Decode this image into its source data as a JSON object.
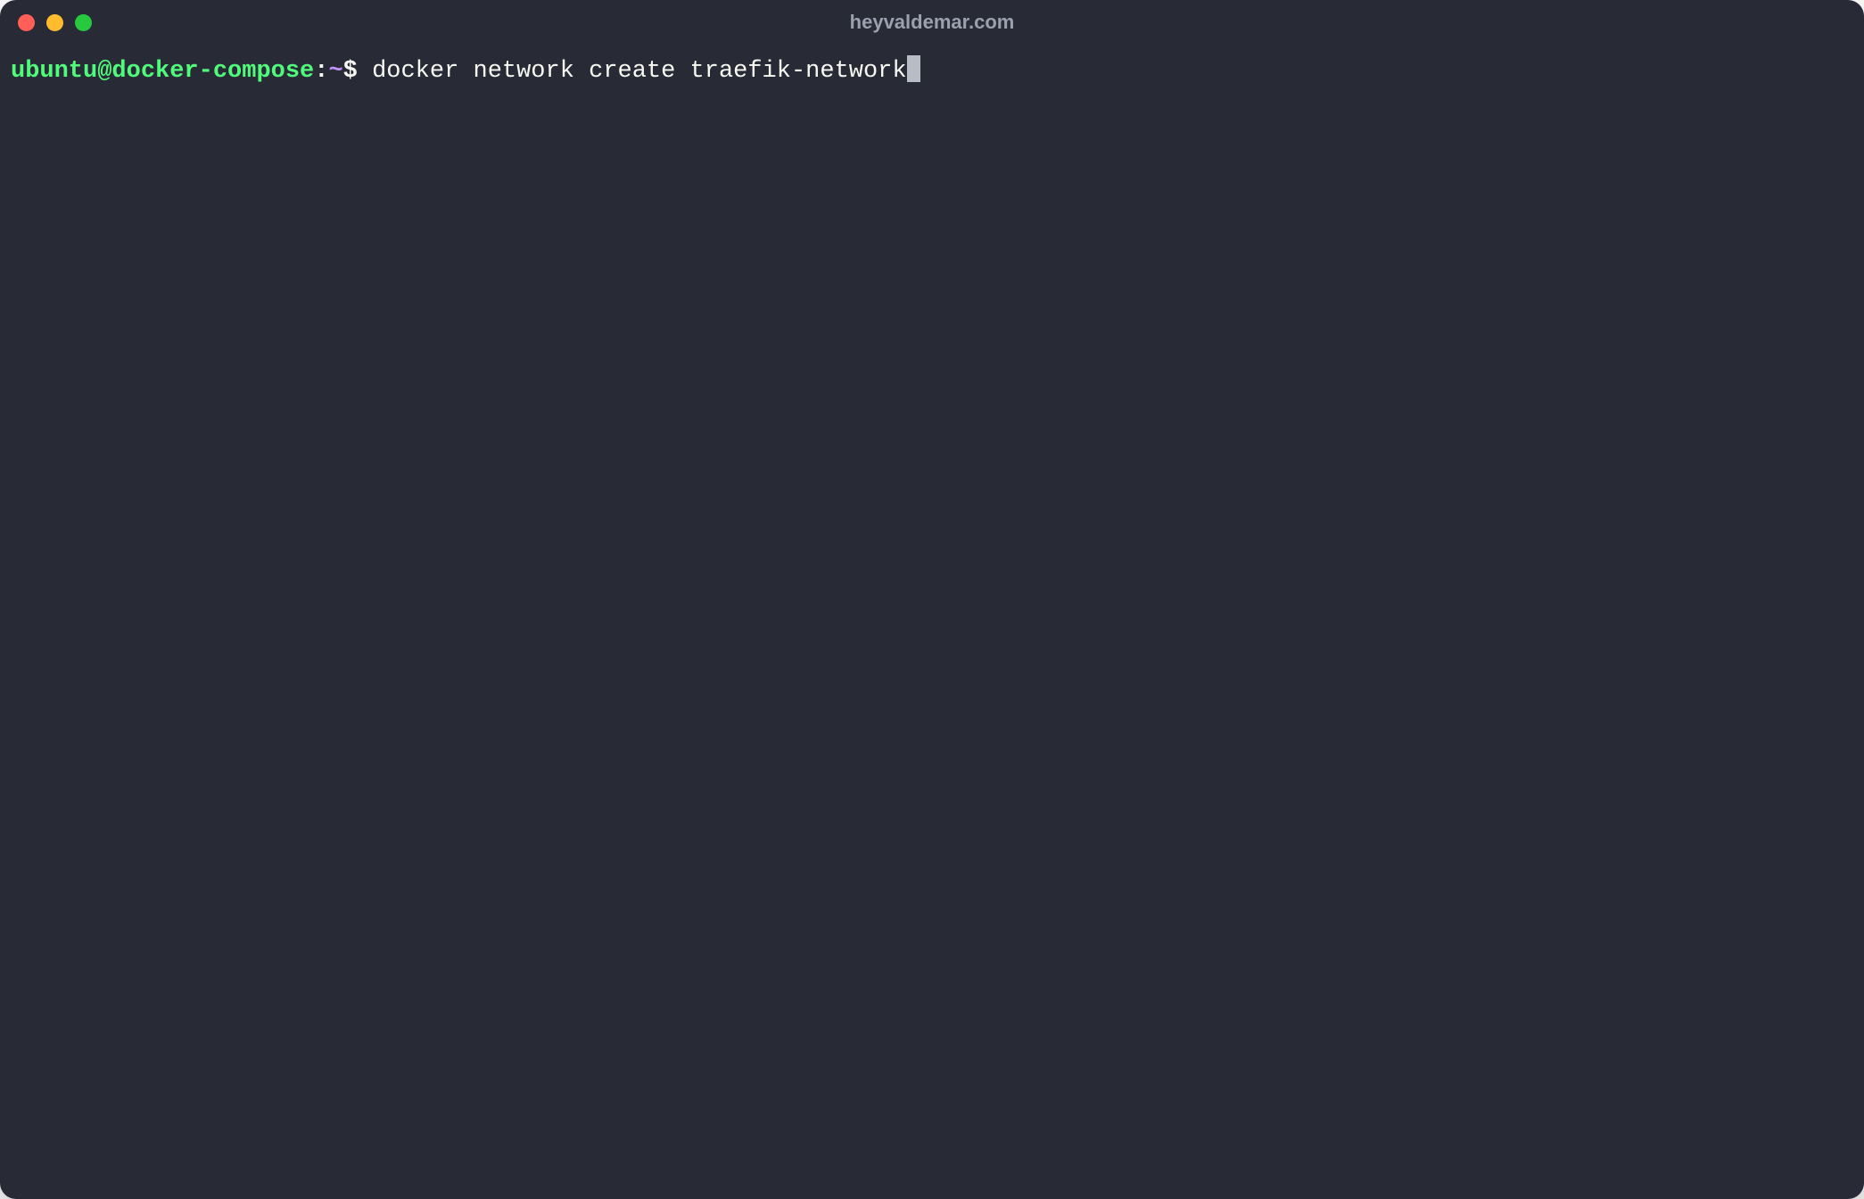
{
  "window": {
    "title": "heyvaldemar.com"
  },
  "prompt": {
    "user_host": "ubuntu@docker-compose",
    "colon": ":",
    "path": "~",
    "symbol": "$"
  },
  "command": "docker network create traefik-network",
  "colors": {
    "background": "#282a36",
    "user_host": "#50fa7b",
    "path": "#bd93f9",
    "text": "#f8f8f2",
    "title": "#9ca0ae",
    "close": "#ff5f56",
    "minimize": "#ffbd2e",
    "maximize": "#27c93f",
    "cursor": "#b8bcc4"
  }
}
